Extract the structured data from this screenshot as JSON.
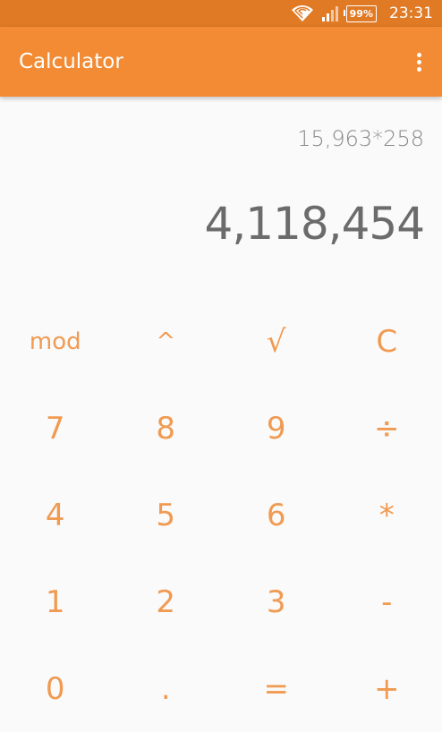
{
  "status_bar": {
    "wifi_icon": "wifi-icon",
    "signal_icon": "signal-icon",
    "battery": "99%",
    "time": "23:31"
  },
  "app_bar": {
    "title": "Calculator",
    "menu_icon": "overflow-menu-icon"
  },
  "display": {
    "expression": "15,963*258",
    "result": "4,118,454"
  },
  "keypad": {
    "rows": [
      [
        "mod",
        "^",
        "√",
        "C"
      ],
      [
        "7",
        "8",
        "9",
        "÷"
      ],
      [
        "4",
        "5",
        "6",
        "*"
      ],
      [
        "1",
        "2",
        "3",
        "-"
      ],
      [
        "0",
        ".",
        "=",
        "+"
      ]
    ]
  },
  "colors": {
    "status_bar": "#e07a25",
    "app_bar": "#f28b34",
    "key_text": "#f09a52",
    "background": "#fafafa"
  }
}
